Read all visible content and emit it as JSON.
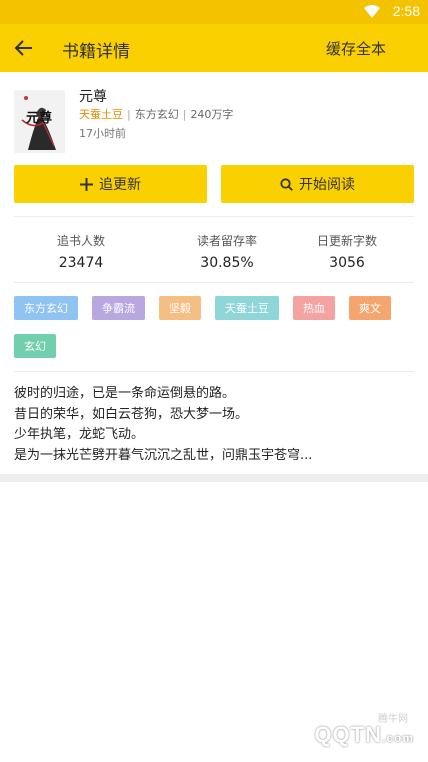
{
  "status_bar": {
    "time": "2:58"
  },
  "app_bar": {
    "title": "书籍详情",
    "cache_label": "缓存全本"
  },
  "book": {
    "title": "元尊",
    "author": "天蚕土豆",
    "category": "东方玄幻",
    "word_count": "240万字",
    "updated": "17小时前",
    "cover_text": "元尊"
  },
  "actions": {
    "follow_label": "追更新",
    "read_label": "开始阅读"
  },
  "stats": [
    {
      "label": "追书人数",
      "value": "23474"
    },
    {
      "label": "读者留存率",
      "value": "30.85%"
    },
    {
      "label": "日更新字数",
      "value": "3056"
    }
  ],
  "tags": [
    {
      "label": "东方玄幻",
      "color": "#8ec3f2"
    },
    {
      "label": "争霸流",
      "color": "#b9a7e0"
    },
    {
      "label": "坚毅",
      "color": "#f5bf84"
    },
    {
      "label": "天蚕土豆",
      "color": "#8ed6d8"
    },
    {
      "label": "热血",
      "color": "#f4a2a2"
    },
    {
      "label": "爽文",
      "color": "#f5a66e"
    },
    {
      "label": "玄幻",
      "color": "#72cfae"
    }
  ],
  "description": [
    "彼时的归途，已是一条命运倒悬的路。",
    "昔日的荣华，如白云苍狗，恐大梦一场。",
    "少年执笔，龙蛇飞动。",
    "是为一抹光芒劈开暮气沉沉之乱世，问鼎玉宇苍穹..."
  ],
  "watermark": {
    "brand": "QQTN",
    "suffix": ".com",
    "site": "腾牛网"
  },
  "icons": {
    "back": "arrow-left-icon",
    "wifi": "wifi-icon",
    "plus": "plus-icon",
    "search": "search-icon"
  }
}
